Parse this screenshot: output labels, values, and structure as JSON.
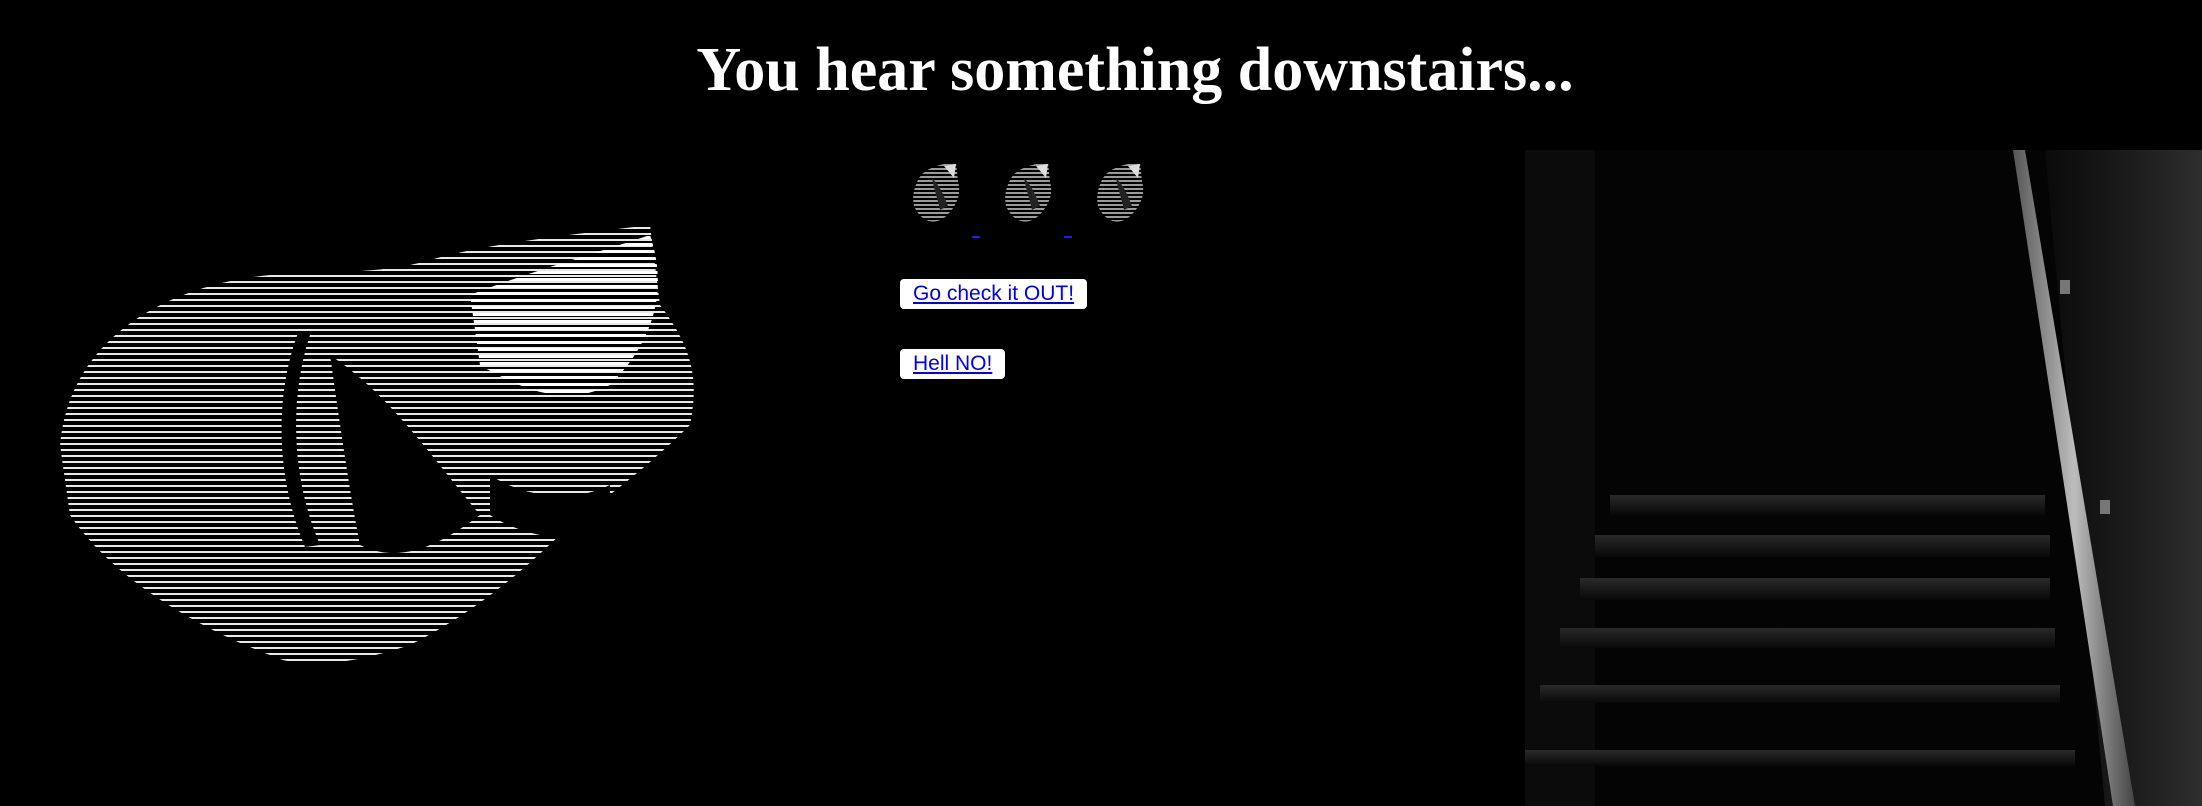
{
  "page": {
    "title": "You hear something downstairs..."
  },
  "icons": {
    "decorative_art": "distorted-hand-icon",
    "photo": "dark-staircase-photo",
    "option_icons": [
      "hand-icon",
      "hand-icon",
      "hand-icon"
    ]
  },
  "choices": {
    "check_label": "Go check it OUT!",
    "no_label": "Hell NO!"
  },
  "colors": {
    "background": "#000000",
    "title": "#ffffff",
    "link": "#0000ee",
    "button_bg": "#ffffff"
  }
}
